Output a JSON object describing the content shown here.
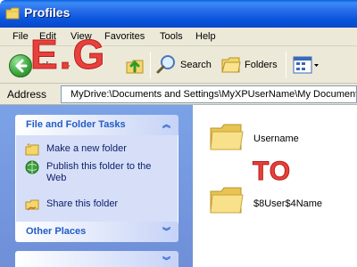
{
  "window": {
    "title": "Profiles"
  },
  "menu": {
    "items": [
      {
        "label": "File"
      },
      {
        "label": "Edit"
      },
      {
        "label": "View"
      },
      {
        "label": "Favorites"
      },
      {
        "label": "Tools"
      },
      {
        "label": "Help"
      }
    ]
  },
  "toolbar": {
    "back_label": "ack",
    "search_label": "Search",
    "folders_label": "Folders"
  },
  "overlay": {
    "eg": "E.G",
    "to": "TO"
  },
  "address": {
    "label": "Address",
    "value": "MyDrive:\\Documents and Settings\\MyXPUserName\\My Documents\\M"
  },
  "tasks": {
    "header": "File and Folder Tasks",
    "items": [
      {
        "label": "Make a new folder",
        "icon": "new-folder-icon"
      },
      {
        "label": "Publish this folder to the Web",
        "icon": "publish-web-icon"
      },
      {
        "label": "Share this folder",
        "icon": "share-folder-icon"
      }
    ]
  },
  "other_places": {
    "header": "Other Places"
  },
  "folders": [
    {
      "name": "Username"
    },
    {
      "name": "$8User$4Name"
    }
  ],
  "colors": {
    "titlebar": "#0a55dd",
    "chrome": "#ece9d8",
    "sidepane": "#7ba2e7",
    "task_link": "#0c1d6b",
    "overlay_red": "#e8403a"
  }
}
